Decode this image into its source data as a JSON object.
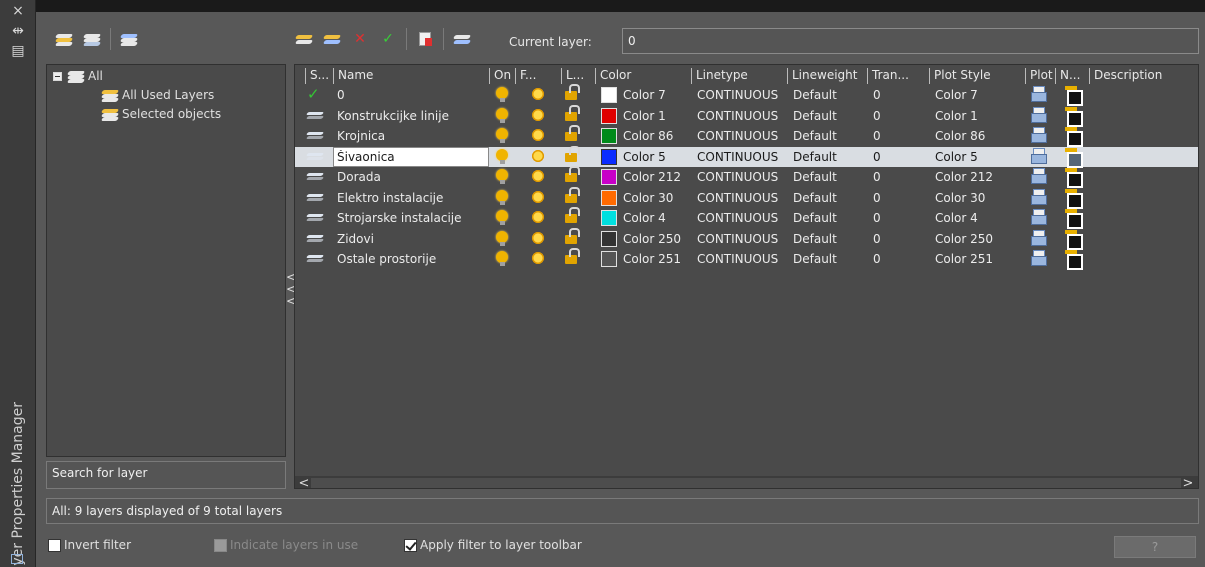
{
  "window": {
    "title": "Layer Properties Manager",
    "close_glyph": "×",
    "autohide_glyph": "⇹",
    "properties_glyph": "▤"
  },
  "toolbar_left": {
    "icons": [
      "new-property-filter-icon",
      "new-group-filter-icon",
      "layer-states-manager-icon"
    ]
  },
  "toolbar_right": {
    "icons": [
      "new-layer-icon",
      "new-layer-vp-frozen-icon",
      "delete-layer-icon",
      "set-current-icon",
      "refresh-icon",
      "settings-icon"
    ],
    "delete_glyph": "✕",
    "current_glyph": "✓",
    "current_layer_label": "Current layer:",
    "current_layer_value": "0"
  },
  "filter_tree": {
    "root": "All",
    "children": [
      "All Used Layers",
      "Selected objects"
    ]
  },
  "search": {
    "placeholder": "Search for layer"
  },
  "columns": [
    "S...",
    "Name",
    "On",
    "F...",
    "L...",
    "Color",
    "Linetype",
    "Lineweight",
    "Tran...",
    "Plot Style",
    "Plot",
    "N...",
    "Description"
  ],
  "layers": [
    {
      "current": true,
      "name": "0",
      "swatch": "#ffffff",
      "color": "Color 7",
      "linetype": "CONTINUOUS",
      "lineweight": "Default",
      "transparency": "0",
      "plot_style": "Color 7",
      "selected": false
    },
    {
      "current": false,
      "name": "Konstrukcijke linije",
      "swatch": "#e00000",
      "color": "Color 1",
      "linetype": "CONTINUOUS",
      "lineweight": "Default",
      "transparency": "0",
      "plot_style": "Color 1",
      "selected": false
    },
    {
      "current": false,
      "name": "Krojnica",
      "swatch": "#008a1a",
      "color": "Color 86",
      "linetype": "CONTINUOUS",
      "lineweight": "Default",
      "transparency": "0",
      "plot_style": "Color 86",
      "selected": false
    },
    {
      "current": false,
      "name": "Šivaonica",
      "swatch": "#0a2cff",
      "color": "Color 5",
      "linetype": "CONTINUOUS",
      "lineweight": "Default",
      "transparency": "0",
      "plot_style": "Color 5",
      "selected": true
    },
    {
      "current": false,
      "name": "Dorada",
      "swatch": "#c800c8",
      "color": "Color 212",
      "linetype": "CONTINUOUS",
      "lineweight": "Default",
      "transparency": "0",
      "plot_style": "Color 212",
      "selected": false
    },
    {
      "current": false,
      "name": "Elektro instalacije",
      "swatch": "#ff6a00",
      "color": "Color 30",
      "linetype": "CONTINUOUS",
      "lineweight": "Default",
      "transparency": "0",
      "plot_style": "Color 30",
      "selected": false
    },
    {
      "current": false,
      "name": "Strojarske instalacije",
      "swatch": "#00e0e0",
      "color": "Color 4",
      "linetype": "CONTINUOUS",
      "lineweight": "Default",
      "transparency": "0",
      "plot_style": "Color 4",
      "selected": false
    },
    {
      "current": false,
      "name": "Zidovi",
      "swatch": "#333333",
      "color": "Color 250",
      "linetype": "CONTINUOUS",
      "lineweight": "Default",
      "transparency": "0",
      "plot_style": "Color 250",
      "selected": false
    },
    {
      "current": false,
      "name": "Ostale prostorije",
      "swatch": "#555555",
      "color": "Color 251",
      "linetype": "CONTINUOUS",
      "lineweight": "Default",
      "transparency": "0",
      "plot_style": "Color 251",
      "selected": false
    }
  ],
  "splitter_glyphs": [
    "<",
    "<",
    "<"
  ],
  "hscroll": {
    "left": "<",
    "right": ">"
  },
  "status": "All: 9 layers displayed of 9 total layers",
  "options": [
    {
      "label": "Invert filter",
      "checked": false,
      "enabled": true
    },
    {
      "label": "Indicate layers in use",
      "checked": false,
      "enabled": false
    },
    {
      "label": "Apply filter to layer toolbar",
      "checked": true,
      "enabled": true
    }
  ],
  "help_button": "?"
}
